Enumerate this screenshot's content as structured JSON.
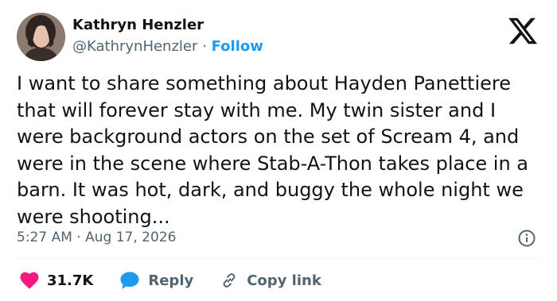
{
  "author": {
    "name": "Kathryn Henzler",
    "handle": "@KathrynHenzler",
    "separator": "·",
    "follow_label": "Follow"
  },
  "tweet": {
    "text": "I want to share something about Hayden Panettiere that will forever stay with me. My twin sister and I were background actors on the set of Scream 4, and were in the scene where Stab-A-Thon takes place in a barn. It was hot, dark, and buggy the whole night we were shooting...",
    "time": "5:27 AM",
    "date_separator": "·",
    "date": "Aug 17, 2026"
  },
  "actions": {
    "likes_count": "31.7K",
    "reply_label": "Reply",
    "copy_link_label": "Copy link"
  },
  "icons": {
    "logo": "x-logo-icon",
    "info": "info-icon",
    "like": "heart-icon",
    "reply": "speech-bubble-icon",
    "copy": "link-icon"
  },
  "colors": {
    "accent": "#1d9bf0",
    "like": "#f91880",
    "text": "#0f1419",
    "secondary": "#536471"
  }
}
